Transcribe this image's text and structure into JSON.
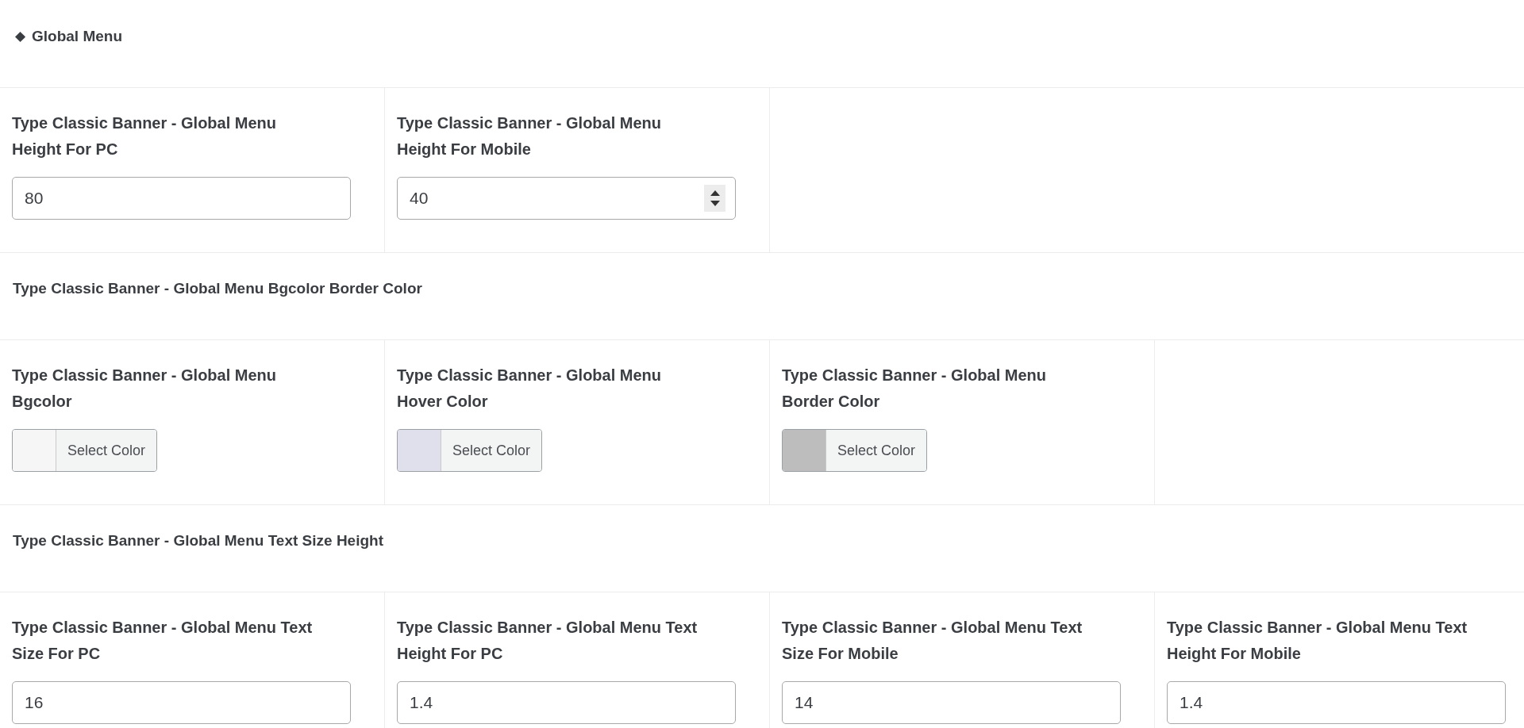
{
  "heading": {
    "marker": "◆",
    "title": "Global Menu"
  },
  "sections": [
    {
      "fields": [
        {
          "kind": "text",
          "label": "Type Classic Banner - Global Menu Height For PC",
          "value": "80"
        },
        {
          "kind": "number",
          "label": "Type Classic Banner - Global Menu Height For Mobile",
          "value": "40"
        }
      ]
    },
    {
      "title": "Type Classic Banner - Global Menu Bgcolor Border Color",
      "fields": [
        {
          "kind": "color",
          "label": "Type Classic Banner - Global Menu Bgcolor",
          "color": "#f5f6f5",
          "button": "Select Color"
        },
        {
          "kind": "color",
          "label": "Type Classic Banner - Global Menu Hover Color",
          "color": "#e0e0ec",
          "button": "Select Color"
        },
        {
          "kind": "color",
          "label": "Type Classic Banner - Global Menu Border Color",
          "color": "#bdbdbd",
          "button": "Select Color"
        }
      ]
    },
    {
      "title": "Type Classic Banner - Global Menu Text Size Height",
      "fields": [
        {
          "kind": "text",
          "label": "Type Classic Banner - Global Menu Text Size For PC",
          "value": "16"
        },
        {
          "kind": "text",
          "label": "Type Classic Banner - Global Menu Text Height For PC",
          "value": "1.4"
        },
        {
          "kind": "text",
          "label": "Type Classic Banner - Global Menu Text Size For Mobile",
          "value": "14"
        },
        {
          "kind": "text",
          "label": "Type Classic Banner - Global Menu Text Height For Mobile",
          "value": "1.4"
        }
      ]
    }
  ]
}
